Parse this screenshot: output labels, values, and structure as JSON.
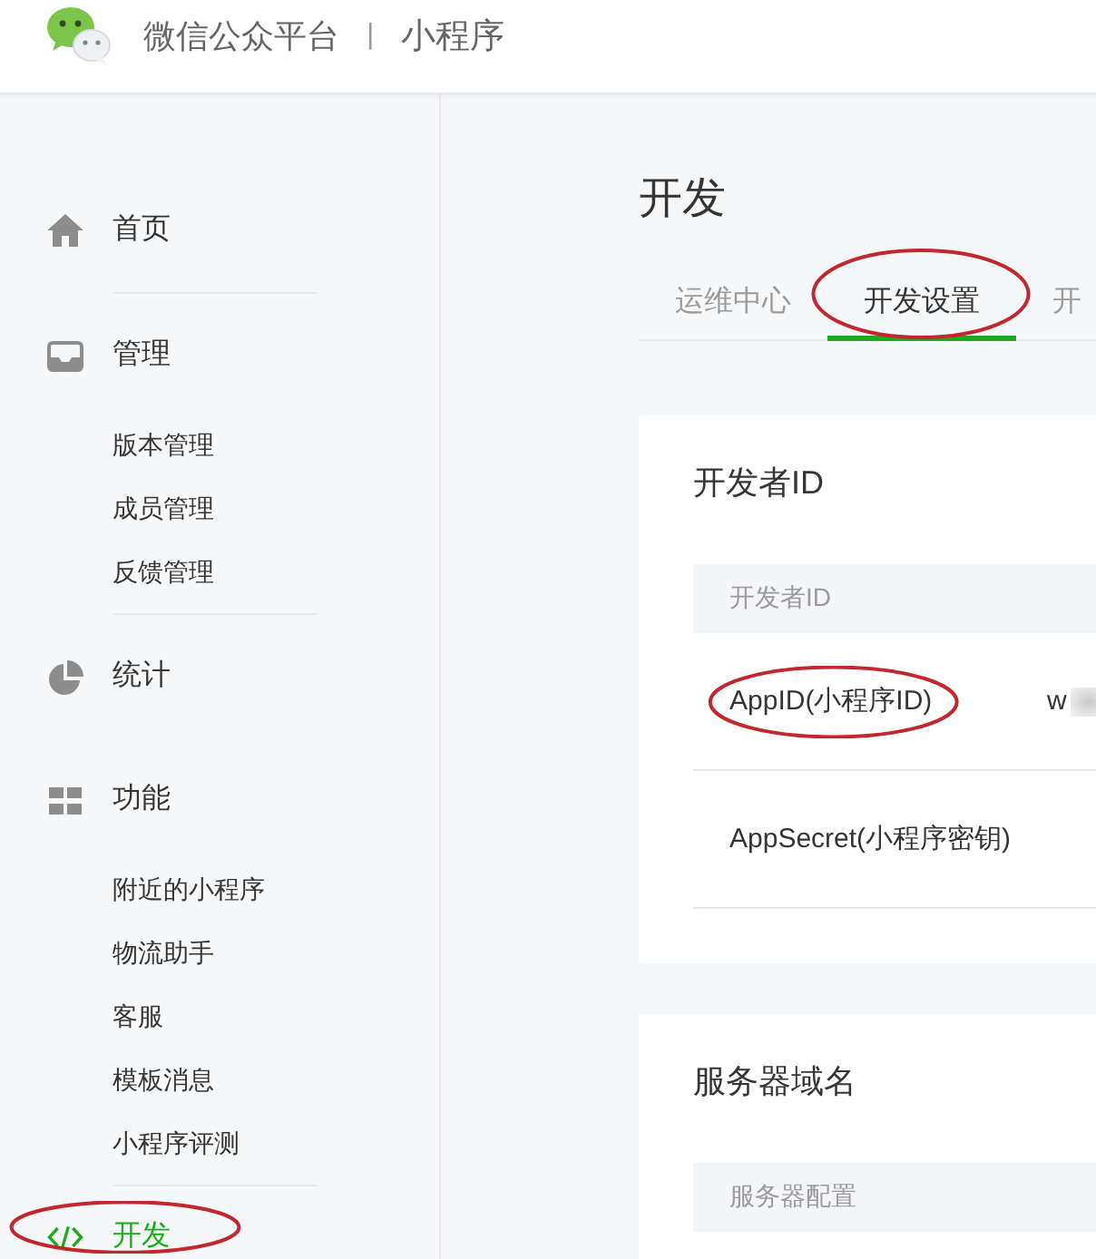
{
  "header": {
    "platform": "微信公众平台",
    "separator": "|",
    "product": "小程序"
  },
  "sidebar": {
    "groups": [
      {
        "items": [
          {
            "label": "首页",
            "selected": false,
            "circled": false
          }
        ]
      },
      {
        "items": [
          {
            "label": "管理",
            "selected": false,
            "circled": false,
            "children": [
              {
                "label": "版本管理",
                "selected": false
              },
              {
                "label": "成员管理",
                "selected": false
              },
              {
                "label": "反馈管理",
                "selected": false
              }
            ]
          }
        ]
      },
      {
        "items": [
          {
            "label": "统计",
            "selected": false,
            "circled": false
          },
          {
            "label": "功能",
            "selected": false,
            "circled": false,
            "children": [
              {
                "label": "附近的小程序",
                "selected": false
              },
              {
                "label": "物流助手",
                "selected": false
              },
              {
                "label": "客服",
                "selected": false
              },
              {
                "label": "模板消息",
                "selected": false
              },
              {
                "label": "小程序评测",
                "selected": false
              }
            ]
          }
        ]
      },
      {
        "items": [
          {
            "label": "开发",
            "selected": true,
            "circled": true
          }
        ]
      }
    ]
  },
  "main": {
    "title": "开发",
    "tabs": [
      {
        "label": "运维中心",
        "selected": false,
        "circled": false
      },
      {
        "label": "开发设置",
        "selected": true,
        "circled": true
      },
      {
        "label": "开",
        "selected": false,
        "circled": false
      }
    ],
    "sections": [
      {
        "title": "开发者ID",
        "table": {
          "header": "开发者ID",
          "rows": [
            {
              "label": "AppID(小程序ID)",
              "circled": true,
              "value": "w",
              "redacted": true
            },
            {
              "label": "AppSecret(小程序密钥)",
              "circled": false
            }
          ]
        }
      },
      {
        "title": "服务器域名",
        "table": {
          "header": "服务器配置"
        }
      }
    ]
  }
}
